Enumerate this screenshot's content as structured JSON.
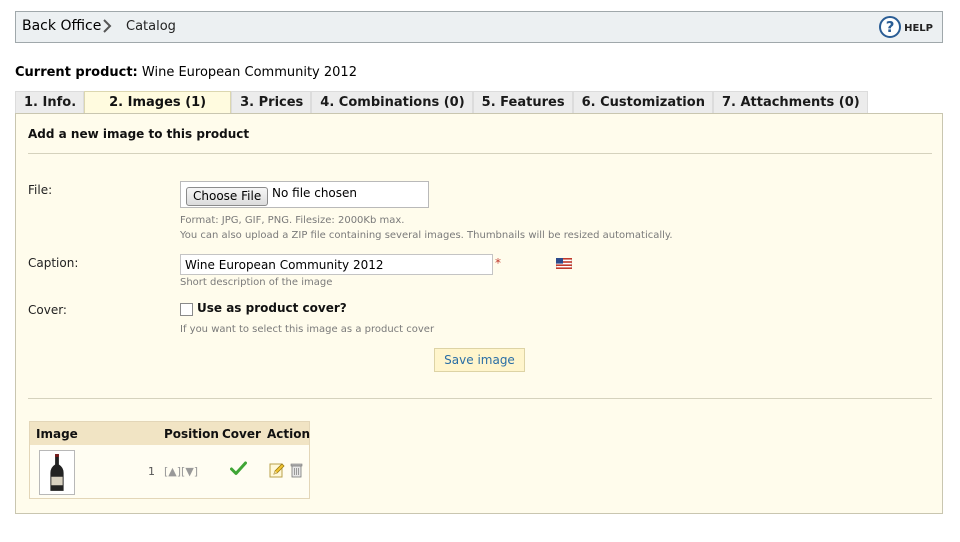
{
  "breadcrumb": {
    "home": "Back Office",
    "current": "Catalog"
  },
  "help": {
    "icon_glyph": "?",
    "label": "HELP"
  },
  "current_product": {
    "label": "Current product:",
    "name": "Wine European Community 2012"
  },
  "tabs": [
    {
      "label": "1. Info."
    },
    {
      "label": "2. Images (1)",
      "active": true
    },
    {
      "label": "3. Prices"
    },
    {
      "label": "4. Combinations (0)"
    },
    {
      "label": "5. Features"
    },
    {
      "label": "6. Customization"
    },
    {
      "label": "7. Attachments (0)"
    }
  ],
  "form": {
    "title": "Add a new image to this product",
    "file": {
      "label": "File:",
      "button": "Choose File",
      "status": "No file chosen",
      "hint1": "Format: JPG, GIF, PNG. Filesize: 2000Kb max.",
      "hint2": "You can also upload a ZIP file containing several images. Thumbnails will be resized automatically."
    },
    "caption": {
      "label": "Caption:",
      "value": "Wine European Community 2012",
      "required_mark": "*",
      "hint": "Short description of the image"
    },
    "cover": {
      "label": "Cover:",
      "checkbox_label": "Use as product cover?",
      "checked": false,
      "hint": "If you want to select this image as a product cover"
    },
    "save_button": "Save image"
  },
  "image_table": {
    "headers": {
      "image": "Image",
      "position": "Position",
      "cover": "Cover",
      "action": "Action"
    },
    "rows": [
      {
        "position": "1",
        "arrows": "[▲][▼]",
        "is_cover": true
      }
    ]
  },
  "colors": {
    "accent_link": "#2a6ea5",
    "panel_bg": "#fffcec",
    "tab_active_bg": "#fffbdf",
    "cover_check": "#3fa535"
  }
}
